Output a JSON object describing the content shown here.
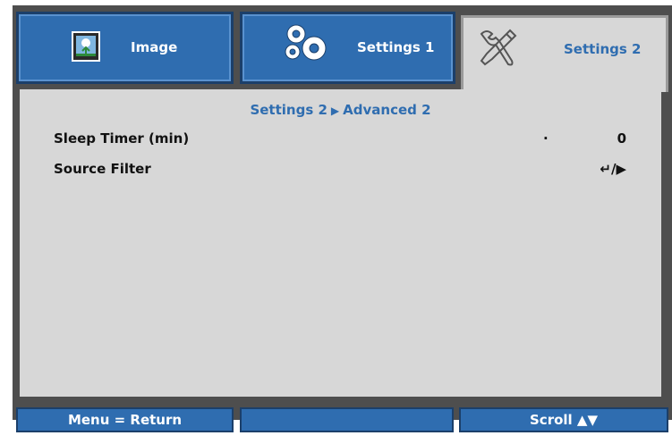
{
  "tabs": [
    {
      "label": "Image",
      "icon": "image-icon",
      "active": false
    },
    {
      "label": "Settings 1",
      "icon": "gears-icon",
      "active": false
    },
    {
      "label": "Settings 2",
      "icon": "tools-icon",
      "active": true
    }
  ],
  "breadcrumb": {
    "parent": "Settings 2",
    "child": "Advanced 2",
    "separator": "▶"
  },
  "rows": [
    {
      "label": "Sleep Timer (min)",
      "marker": "·",
      "value": "0"
    },
    {
      "label": "Source Filter",
      "value": "↵/▶"
    }
  ],
  "footer": {
    "left": "Menu = Return",
    "middle": "",
    "right": "Scroll ▲▼"
  },
  "colors": {
    "accent": "#2f6db0",
    "panel": "#d7d7d7",
    "frame": "#4e4e4e"
  }
}
